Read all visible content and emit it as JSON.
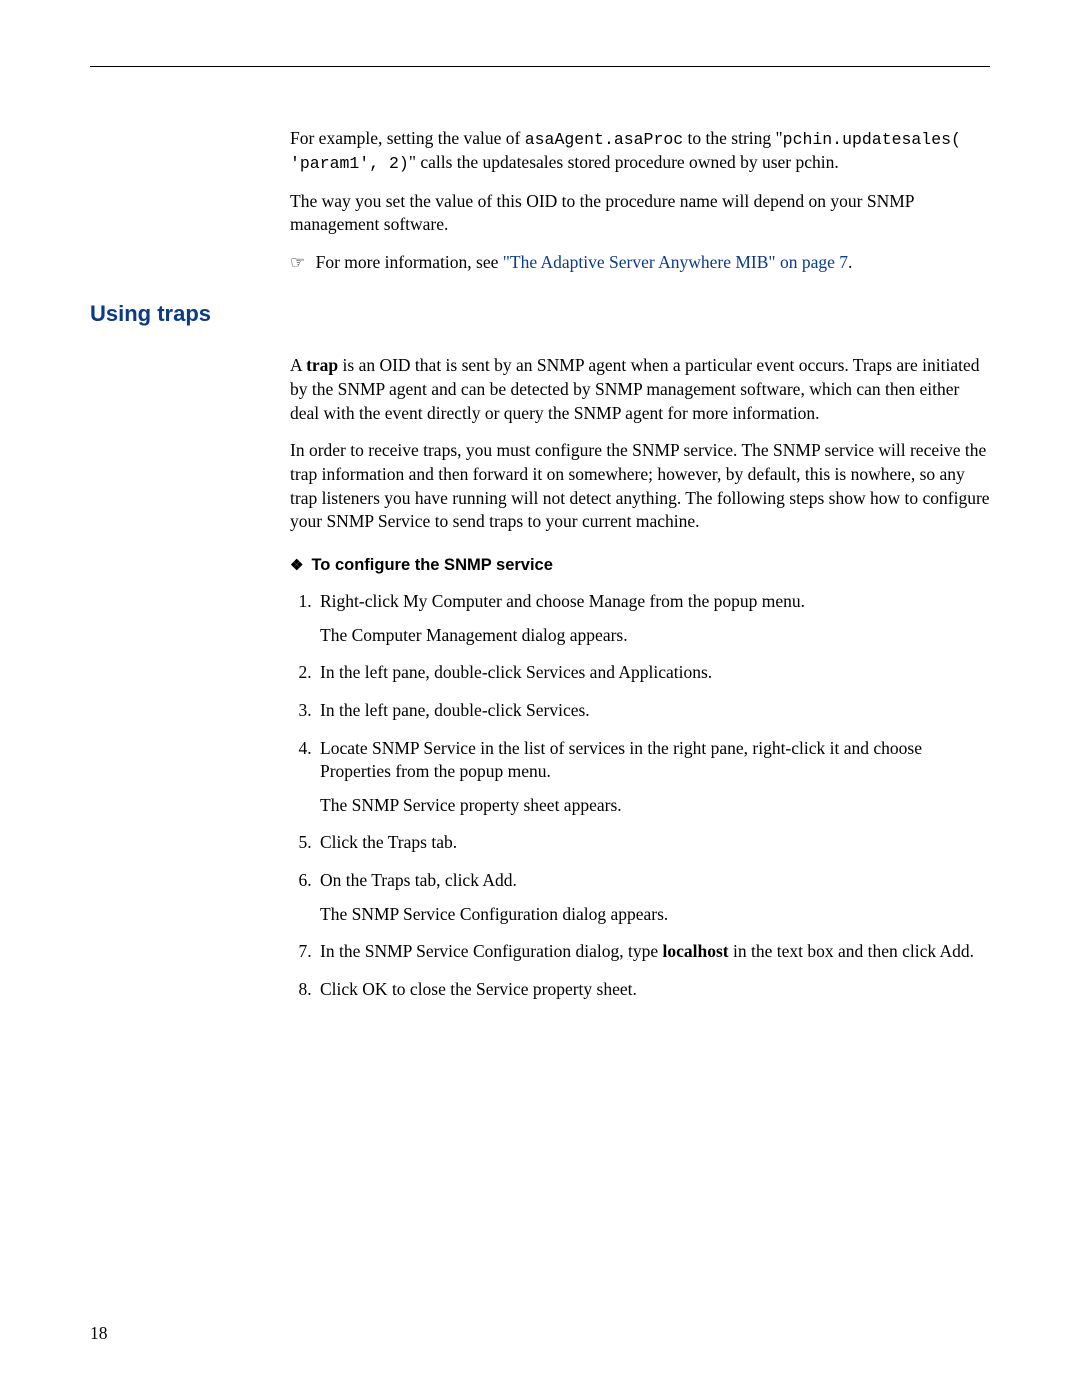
{
  "intro": {
    "p1_a": "For example, setting the value of ",
    "p1_code1": "asaAgent.asaProc",
    "p1_b": " to the string \"",
    "p1_code2": "pchin.updatesales( 'param1', 2)",
    "p1_c": "\" calls the updatesales stored procedure owned by user pchin.",
    "p2": "The way you set the value of this OID to the procedure name will depend on your SNMP management software.",
    "more_prefix": "For more information, see ",
    "more_link": "\"The Adaptive Server Anywhere MIB\" on page 7",
    "more_suffix": "."
  },
  "section": {
    "title": "Using traps",
    "p1_a": "A ",
    "p1_bold": "trap",
    "p1_b": " is an OID that is sent by an SNMP agent when a particular event occurs. Traps are initiated by the SNMP agent and can be detected by SNMP management software, which can then either deal with the event directly or query the SNMP agent for more information.",
    "p2": "In order to receive traps, you must configure the SNMP service. The SNMP service will receive the trap information and then forward it on somewhere; however, by default, this is nowhere, so any trap listeners you have running will not detect anything. The following steps show how to configure your SNMP Service to send traps to your current machine."
  },
  "procedure": {
    "heading": "To configure the SNMP service",
    "steps": [
      {
        "main": "Right-click My Computer and choose Manage from the popup menu.",
        "sub": "The Computer Management dialog appears."
      },
      {
        "main": "In the left pane, double-click Services and Applications."
      },
      {
        "main": "In the left pane, double-click Services."
      },
      {
        "main": "Locate SNMP Service in the list of services in the right pane, right-click it and choose Properties from the popup menu.",
        "sub": "The SNMP Service property sheet appears."
      },
      {
        "main": "Click the Traps tab."
      },
      {
        "main": "On the Traps tab, click Add.",
        "sub": "The SNMP Service Configuration dialog appears."
      },
      {
        "main_a": "In the SNMP Service Configuration dialog, type ",
        "main_bold": "localhost",
        "main_b": " in the text box and then click Add."
      },
      {
        "main": "Click OK to close the Service property sheet."
      }
    ]
  },
  "page_number": "18"
}
